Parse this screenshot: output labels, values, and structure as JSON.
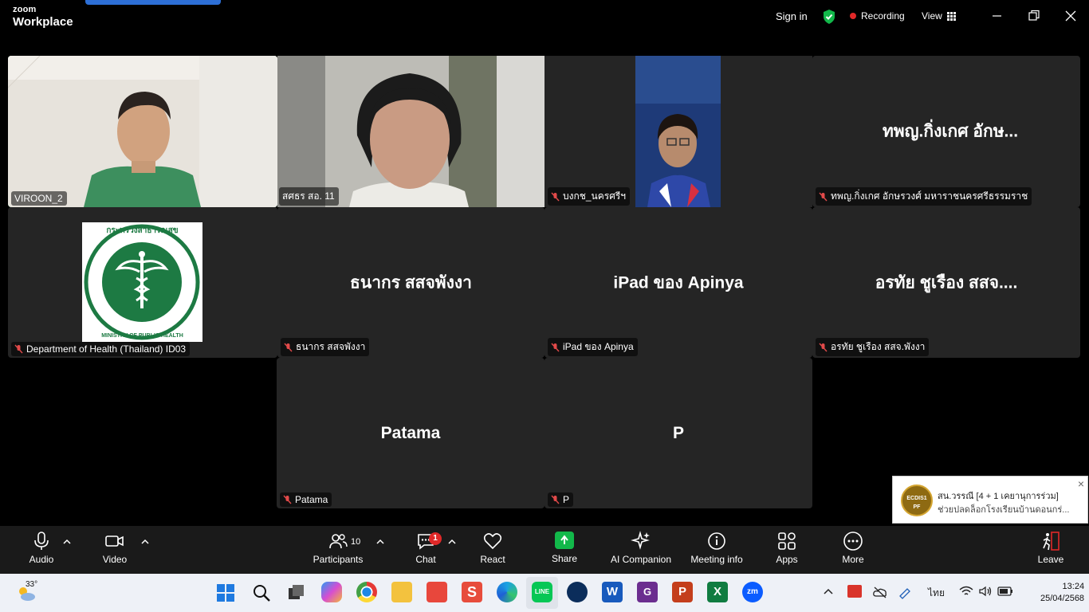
{
  "app": {
    "brand_small": "zoom",
    "brand_large": "Workplace"
  },
  "header": {
    "sign_in": "Sign in",
    "recording": "Recording",
    "view": "View"
  },
  "tiles": [
    {
      "name_tag": "VIROON_2",
      "type": "video",
      "active": true
    },
    {
      "name_tag": "สศธร สอ. 11",
      "type": "video"
    },
    {
      "name_tag": "บงกช_นครศรีฯ",
      "type": "video"
    },
    {
      "name_tag": "ทพญ.กิ่งเกศ อักษรวงศ์ มหาราชนครศรีธรรมราช",
      "center_name": "ทพญ.กิ่งเกศ อักษ...",
      "type": "name"
    },
    {
      "name_tag": "Department of Health (Thailand) ID03",
      "type": "logo",
      "logo_text": "MINISTRY OF PUBLIC HEALTH",
      "logo_thai": "กระทรวงสาธารณสุข"
    },
    {
      "name_tag": "ธนากร สสจพังงา",
      "center_name": "ธนากร สสจพังงา",
      "type": "name"
    },
    {
      "name_tag": "iPad ของ Apinya",
      "center_name": "iPad ของ Apinya",
      "type": "name"
    },
    {
      "name_tag": "อรทัย ชูเรือง สสจ.พังงา",
      "center_name": "อรทัย ชูเรือง สสจ....",
      "type": "name"
    },
    {
      "name_tag": "Patama",
      "center_name": "Patama",
      "type": "name"
    },
    {
      "name_tag": "P",
      "center_name": "P",
      "type": "name"
    }
  ],
  "toolbar": {
    "audio": "Audio",
    "video": "Video",
    "participants": "Participants",
    "participants_count": "10",
    "chat": "Chat",
    "chat_badge": "1",
    "react": "React",
    "share": "Share",
    "ai_companion": "AI Companion",
    "meeting_info": "Meeting info",
    "apps": "Apps",
    "more": "More",
    "leave": "Leave"
  },
  "toast": {
    "avatar_text_1": "ECDIS1",
    "avatar_text_2": "PF",
    "title": "สน.วรรณี [4 + 1 เคยานุการร่วม]",
    "message": "ช่วยปลดล็อกโรงเรียนบ้านดอนกร่..."
  },
  "taskbar": {
    "weather_temp": "33°",
    "language": "ไทย",
    "time": "13:24",
    "date": "25/04/2568"
  },
  "colors": {
    "active_border": "#28c76f",
    "recording_dot": "#e02828",
    "share_green": "#12b84a",
    "moph_green": "#1d7a43"
  }
}
